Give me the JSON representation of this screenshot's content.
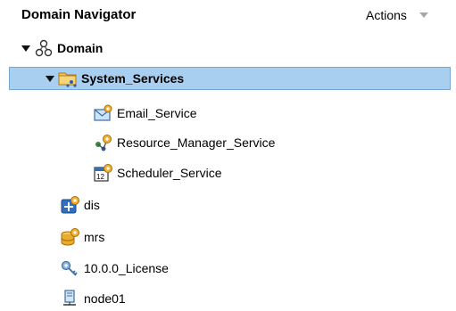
{
  "panel": {
    "title": "Domain Navigator",
    "actions_label": "Actions"
  },
  "tree": {
    "domain": "Domain",
    "system_services": "System_Services",
    "email_service": "Email_Service",
    "resource_manager_service": "Resource_Manager_Service",
    "scheduler_service": "Scheduler_Service",
    "dis": "dis",
    "mrs": "mrs",
    "license": "10.0.0_License",
    "node": "node01"
  },
  "icons": {
    "domain": "domain-network-icon",
    "system_services": "services-folder-icon",
    "email_service": "email-service-icon",
    "resource_manager_service": "resource-manager-service-icon",
    "scheduler_service": "scheduler-service-icon",
    "dis": "data-integration-service-icon",
    "mrs": "repository-service-icon",
    "license": "license-key-icon",
    "node": "node-computer-icon"
  },
  "colors": {
    "selection": "#a9cff0",
    "selection_border": "#7aa6d2"
  }
}
